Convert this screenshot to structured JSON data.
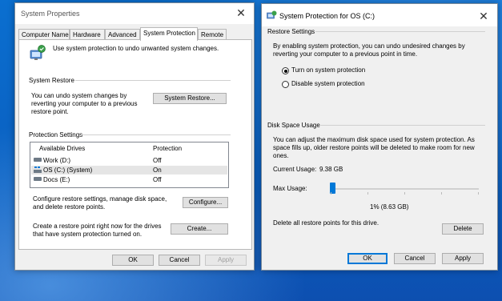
{
  "sys": {
    "title": "System Properties",
    "tabs": [
      {
        "label": "Computer Name"
      },
      {
        "label": "Hardware"
      },
      {
        "label": "Advanced"
      },
      {
        "label": "System Protection"
      },
      {
        "label": "Remote"
      }
    ],
    "intro": "Use system protection to undo unwanted system changes.",
    "restore_group": "System Restore",
    "restore_desc": "You can undo system changes by reverting your computer to a previous restore point.",
    "restore_btn": "System Restore...",
    "protection_group": "Protection Settings",
    "col_drives": "Available Drives",
    "col_protection": "Protection",
    "drives": [
      {
        "name": "Work (D:)",
        "protection": "Off"
      },
      {
        "name": "OS (C:) (System)",
        "protection": "On"
      },
      {
        "name": "Docs (E:)",
        "protection": "Off"
      }
    ],
    "configure_desc": "Configure restore settings, manage disk space, and delete restore points.",
    "configure_btn": "Configure...",
    "create_desc": "Create a restore point right now for the drives that have system protection turned on.",
    "create_btn": "Create...",
    "ok": "OK",
    "cancel": "Cancel",
    "apply": "Apply"
  },
  "dlg": {
    "title": "System Protection for OS (C:)",
    "restore_settings": "Restore Settings",
    "restore_desc": "By enabling system protection, you can undo undesired changes by reverting your computer to a previous point in time.",
    "radio_on": "Turn on system protection",
    "radio_off": "Disable system protection",
    "disk_usage": "Disk Space Usage",
    "disk_desc": "You can adjust the maximum disk space used for system protection. As space fills up, older restore points will be deleted to make room for new ones.",
    "current_label": "Current Usage:",
    "current_value": "9.38 GB",
    "max_label": "Max Usage:",
    "max_value": "1% (8.63 GB)",
    "max_percent": 1,
    "delete_desc": "Delete all restore points for this drive.",
    "delete_btn": "Delete",
    "ok": "OK",
    "cancel": "Cancel",
    "apply": "Apply"
  }
}
